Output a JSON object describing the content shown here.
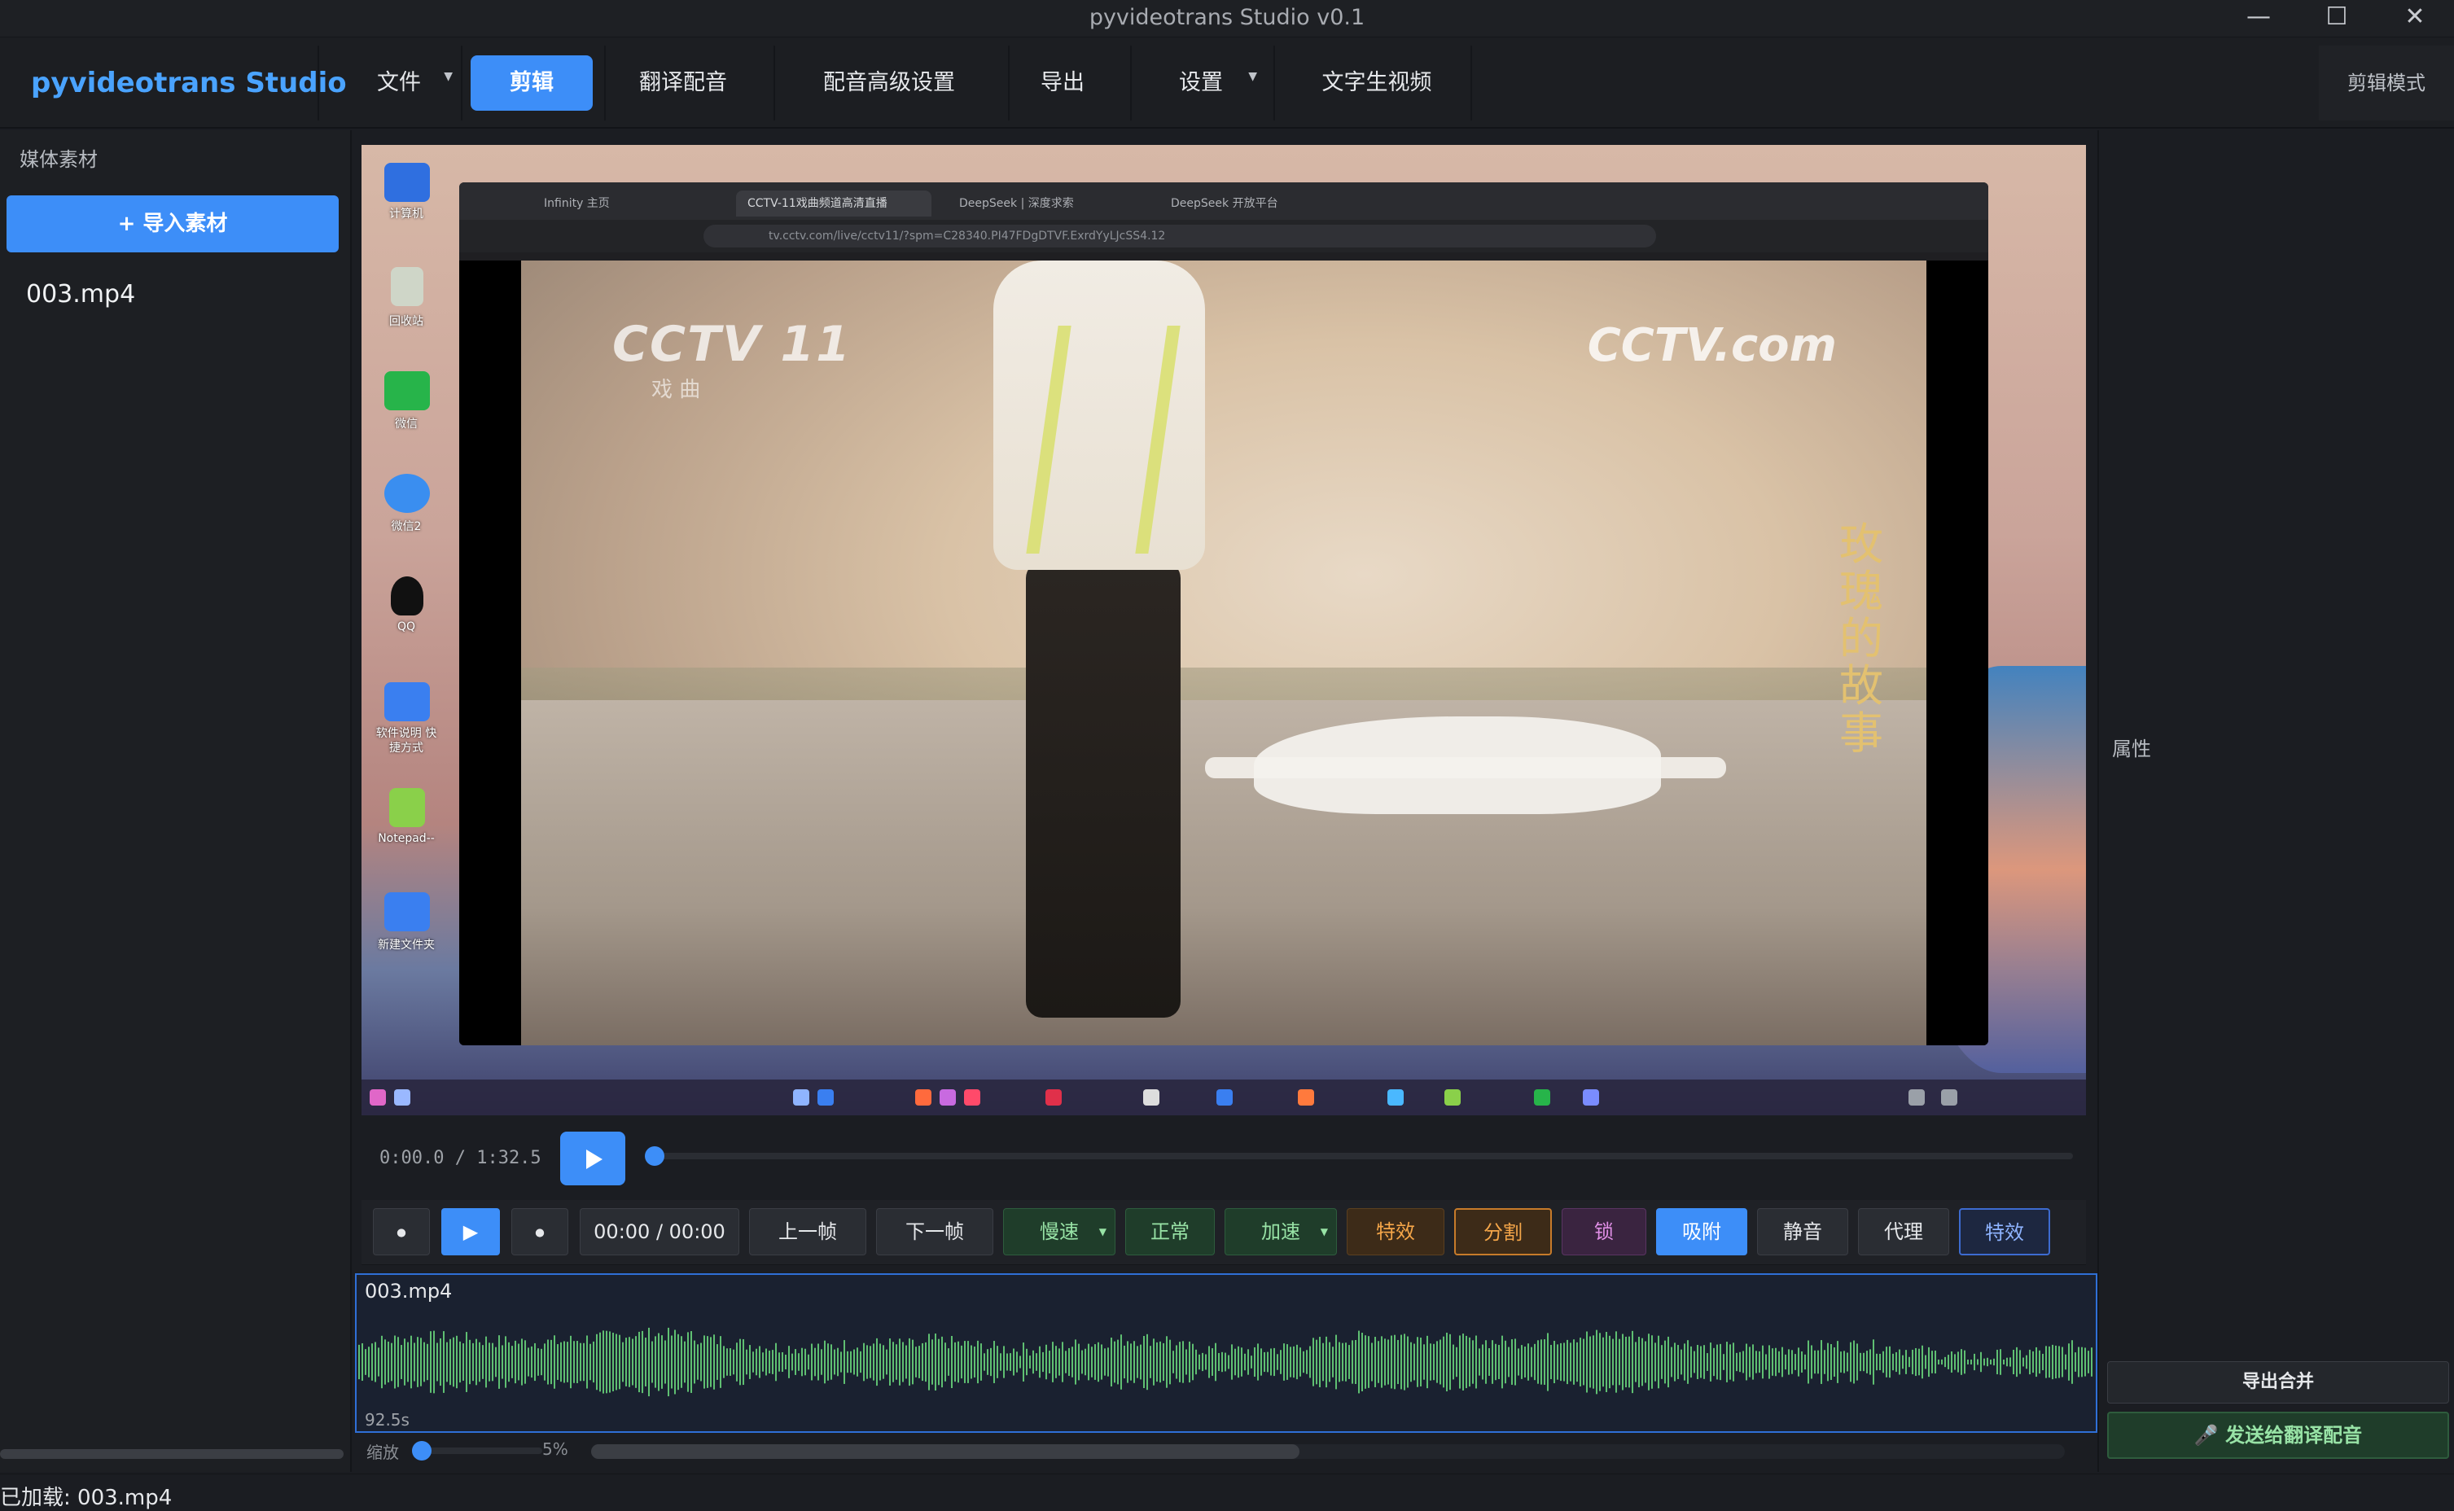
{
  "window": {
    "title": "pyvideotrans Studio v0.1",
    "min_glyph": "—",
    "max_glyph": "☐",
    "close_glyph": "✕"
  },
  "menubar": {
    "brand": "pyvideotrans Studio",
    "items": [
      {
        "label": "文件",
        "has_dropdown": true
      },
      {
        "label": "剪辑",
        "active": true
      },
      {
        "label": "翻译配音"
      },
      {
        "label": "配音高级设置"
      },
      {
        "label": "导出"
      },
      {
        "label": "设置",
        "has_dropdown": true
      },
      {
        "label": "文字生视频"
      }
    ],
    "mode": "剪辑模式"
  },
  "left_panel": {
    "title": "媒体素材",
    "import_button": "+ 导入素材",
    "media_items": [
      "003.mp4"
    ]
  },
  "preview": {
    "desktop_icons": [
      {
        "label": "计算机",
        "icon": "computer-icon",
        "color": "#2f6fe0"
      },
      {
        "label": "回收站",
        "icon": "recycle-bin-icon",
        "color": "#cfd6c8"
      },
      {
        "label": "微信",
        "icon": "wechat-icon",
        "color": "#27b44a"
      },
      {
        "label": "微信2",
        "icon": "wechat2-icon",
        "color": "#3a8ef0"
      },
      {
        "label": "QQ",
        "icon": "qq-icon",
        "color": "#111111"
      },
      {
        "label": "软件说明 快捷方式",
        "icon": "folder-shortcut-icon",
        "color": "#3a7ff0"
      },
      {
        "label": "Notepad--",
        "icon": "notepad-icon",
        "color": "#8ad04a"
      },
      {
        "label": "新建文件夹",
        "icon": "folder-icon",
        "color": "#3a7ff0"
      }
    ],
    "browser_tabs": [
      "Infinity 主页",
      "CCTV-11戏曲频道高清直播",
      "DeepSeek | 深度求索",
      "DeepSeek 开放平台"
    ],
    "url": "tv.cctv.com/live/cctv11/?spm=C28340.PI47FDgDTVF.ExrdYyLJcSS4.12",
    "channel_logo": "CCTV 11",
    "channel_sub": "戏 曲",
    "site_logo": "CCTV.com",
    "video_title": "玫瑰的故事"
  },
  "playback": {
    "timecode": "0:00.0 / 1:32.5",
    "play_icon": "play-icon",
    "progress": 0.0
  },
  "toolbar": {
    "prev_marker": "⦁",
    "next_marker": "⦁",
    "time_display": "00:00 / 00:00",
    "prev_frame": "上一帧",
    "next_frame": "下一帧",
    "slow": "慢速",
    "normal": "正常",
    "fast": "加速",
    "effects1": "特效",
    "split": "分割",
    "lock": "锁",
    "snap": "吸附",
    "mute": "静音",
    "proxy": "代理",
    "effects2": "特效"
  },
  "timeline": {
    "clip_name": "003.mp4",
    "clip_duration": "92.5s",
    "zoom_label": "缩放",
    "zoom_value": "5%",
    "zoom_level": 0.05,
    "wave_color": "#5fbf72"
  },
  "right_panel": {
    "properties_label": "属性",
    "export_button": "导出合并",
    "send_button": "🎤 发送给翻译配音"
  },
  "status": {
    "text": "已加载: 003.mp4"
  },
  "colors": {
    "accent": "#3d8ef8",
    "green": "#98e3a6",
    "orange": "#f5a649",
    "purple": "#e08fe6"
  }
}
